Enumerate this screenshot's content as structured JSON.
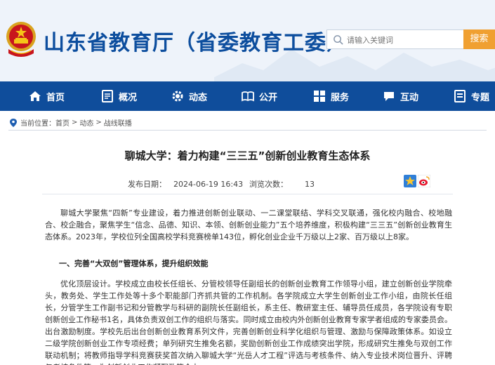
{
  "site": {
    "title": "山东省教育厅（省委教育工委）"
  },
  "search": {
    "placeholder": "请输入关键词",
    "button_label": "搜索"
  },
  "nav": {
    "items": [
      {
        "label": "首页",
        "icon": "home-icon"
      },
      {
        "label": "概况",
        "icon": "document-icon"
      },
      {
        "label": "动态",
        "icon": "gear-icon"
      },
      {
        "label": "公开",
        "icon": "book-icon"
      },
      {
        "label": "服务",
        "icon": "grid-icon"
      },
      {
        "label": "互动",
        "icon": "chat-icon"
      },
      {
        "label": "专题",
        "icon": "file-list-icon"
      }
    ]
  },
  "breadcrumb": {
    "prefix": "当前位置：",
    "items": [
      "首页",
      "动态",
      "战线联播"
    ],
    "separator": ">"
  },
  "article": {
    "title": "聊城大学：着力构建“三三五”创新创业教育生态体系",
    "published_label": "发布日期：",
    "published_value": "2024-06-19 16:43",
    "views_label": "浏览次数：",
    "views_value": "13",
    "para1": "聊城大学聚焦“四新”专业建设，着力推进创新创业联动、一二课堂联结、学科交叉联通，强化校内融合、校地融合、校企融合，聚焦学生“信念、品德、知识、本领、创新创业能力”五个培养维度，积极构建“三三五”创新创业教育生态体系。2023年，学校位列全国高校学科竞赛榜单143位，孵化创业企业千万级以上2家、百万级以上8家。",
    "section1_heading": "一、完善“大双创”管理体系，提升组织效能",
    "para2": "优化顶层设计。学校成立由校长任组长、分管校领导任副组长的创新创业教育工作领导小组，建立创新创业学院牵头，教务处、学生工作处等十多个职能部门齐抓共管的工作机制。各学院成立大学生创新创业工作小组，由院长任组长，分管学生工作副书记和分管教学与科研的副院长任副组长，系主任、教研室主任、辅导员任成员，各学院设有专职创新创业工作秘书1名，具体负责双创工作的组织与落实。同时成立由校内外创新创业教育专家学者组成的专家委员会。出台激励制度。学校先后出台创新创业教育系列文件，完善创新创业科学化组织与管理、激励与保障政策体系。如设立二级学院创新创业工作专项经费；单列研究生推免名额，奖励创新创业工作成绩突出学院，形成研究生推免与双创工作联动机制；将教师指导学科竞赛获奖首次纳入聊城大学“光岳人才工程”评选与考核条件、纳入专业技术岗位晋升、评聘与考核条件等，为创新创业工作凝聚政策合力。"
  },
  "share": {
    "items": [
      "qzone-icon",
      "weibo-icon"
    ]
  },
  "colors": {
    "brand_blue": "#0f4d9b",
    "title_blue": "#0d4e9e",
    "search_orange": "#f0a031"
  }
}
